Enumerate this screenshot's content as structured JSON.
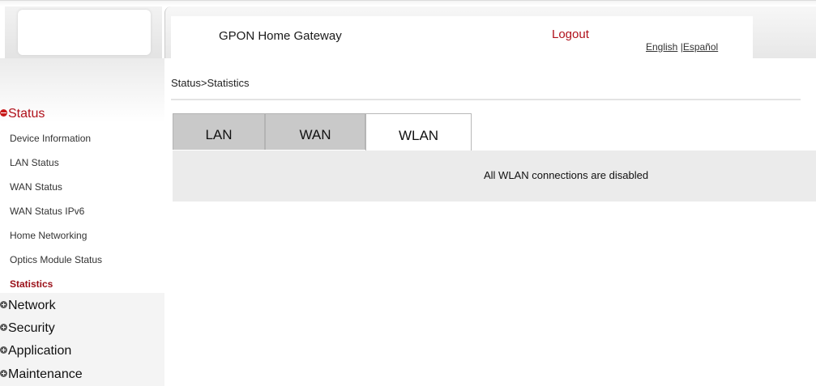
{
  "header": {
    "title": "GPON Home Gateway",
    "logout": "Logout",
    "lang_english": "English",
    "lang_separator": " |",
    "lang_espanol": "Español"
  },
  "breadcrumb": "Status>Statistics",
  "sidebar": {
    "status_label": "Status",
    "status_items": [
      "Device Information",
      "LAN Status",
      "WAN Status",
      "WAN Status IPv6",
      "Home Networking",
      "Optics Module Status",
      "Statistics"
    ],
    "active_item": "Statistics",
    "sections": [
      "Network",
      "Security",
      "Application",
      "Maintenance"
    ]
  },
  "tabs": {
    "items": [
      "LAN",
      "WAN",
      "WLAN"
    ],
    "active": "WLAN"
  },
  "panel": {
    "message": "All WLAN connections are disabled"
  },
  "colors": {
    "accent_red": "#b0101a",
    "tab_inactive": "#c9c9c9",
    "panel_bg": "#ebebeb"
  }
}
